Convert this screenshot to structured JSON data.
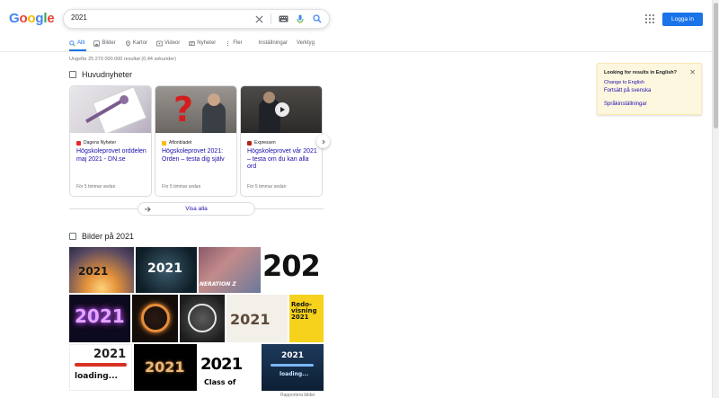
{
  "logo": {
    "letters": [
      "G",
      "o",
      "o",
      "g",
      "l",
      "e"
    ],
    "colors": [
      "#4285f4",
      "#ea4335",
      "#fbbc05",
      "#4285f4",
      "#34a853",
      "#ea4335"
    ]
  },
  "search": {
    "value": "2021"
  },
  "header": {
    "login_label": "Logga in"
  },
  "tabs": [
    {
      "label": "Allt",
      "icon": "search-icon",
      "active": true
    },
    {
      "label": "Bilder",
      "icon": "image-icon"
    },
    {
      "label": "Kartor",
      "icon": "map-pin-icon"
    },
    {
      "label": "Videor",
      "icon": "video-icon"
    },
    {
      "label": "Nyheter",
      "icon": "news-icon"
    },
    {
      "label": "Fler",
      "icon": "more-vert-icon"
    }
  ],
  "tools": {
    "settings": "Inställningar",
    "tools": "Verktyg"
  },
  "result_stats": "Ungefär 25 270 000 000 resultat (0,44 sekunder)",
  "news": {
    "title": "Huvudnyheter",
    "cards": [
      {
        "source": "Dagens Nyheter",
        "headline": "Högskoleprovet orddelen maj 2021 - DN.se",
        "time": "För 5 timmar sedan",
        "source_color": "#e8262e"
      },
      {
        "source": "Aftonbladet",
        "headline": "Högskoleprovet 2021: Orden – testa dig själv",
        "time": "För 5 timmar sedan",
        "source_color": "#fbbc04"
      },
      {
        "source": "Expressen",
        "headline": "Högskoleprovet vår 2021 – testa om du kan alla ord",
        "time": "För 5 timmar sedan",
        "source_color": "#b3261e"
      }
    ],
    "show_all": "Visa alla"
  },
  "images": {
    "title": "Bilder på 2021",
    "tiles": [
      {
        "text": "2021"
      },
      {
        "text": "2021"
      },
      {
        "text": "NERATION Z"
      },
      {
        "text": "202"
      },
      {
        "text": "2021"
      },
      {
        "text": ""
      },
      {
        "text": ""
      },
      {
        "text": "2021"
      },
      {
        "text": "Redo-visning 2021"
      },
      {
        "text": "2021"
      },
      {
        "text": "loading..."
      },
      {
        "text": "2021"
      },
      {
        "text": "2021"
      },
      {
        "text": "Class of"
      },
      {
        "text": "2021"
      },
      {
        "text": "loading..."
      }
    ],
    "more": "Rapportera bilder"
  },
  "lang_panel": {
    "title": "Looking for results in English?",
    "change": "Change to English",
    "continue": "Fortsätt på svenska",
    "settings": "Språkinställningar"
  }
}
